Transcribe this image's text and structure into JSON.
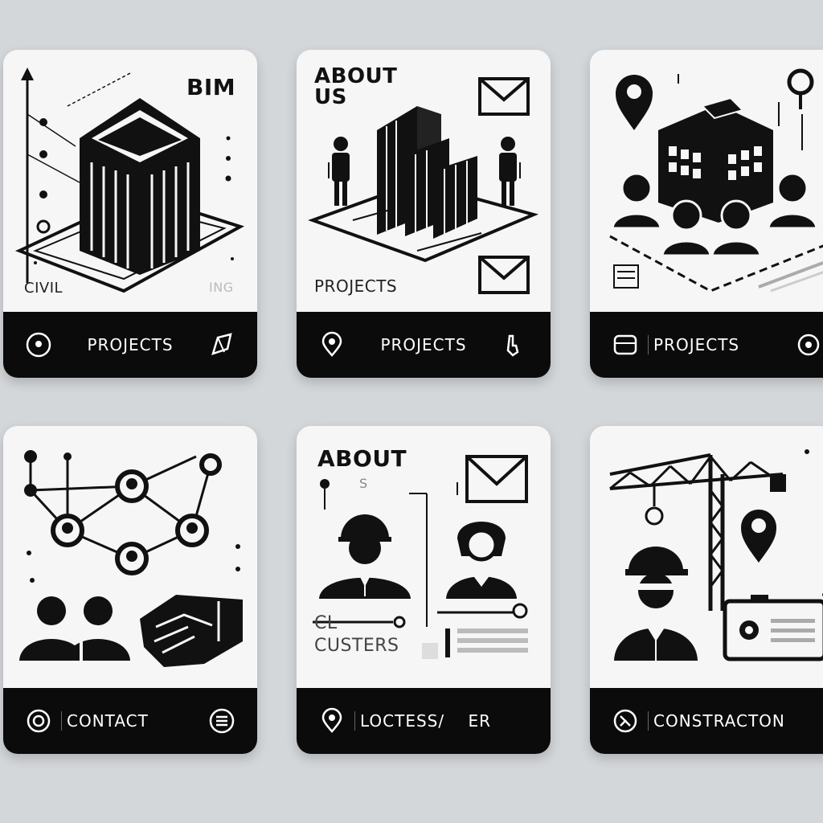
{
  "cards": [
    {
      "art_title": "BIM",
      "art_caption": "CIVIL",
      "art_faint": "ING",
      "footer_label": "PROJECTS",
      "left_icon": "location-pin-icon",
      "right_icon": "pen-nib-icon"
    },
    {
      "art_title": "ABOUT\nUS",
      "art_caption": "PROJECTS",
      "footer_label": "PROJECTS",
      "left_icon": "location-pin-icon",
      "right_icon": "hand-icon"
    },
    {
      "footer_label": "PROJECTS",
      "left_icon": "box-icon",
      "right_icon": "gear-icon"
    },
    {
      "footer_label": "CONTACT",
      "left_icon": "target-icon",
      "right_icon": "list-icon"
    },
    {
      "art_title": "ABOUT",
      "art_faint": "S",
      "art_caption": "CL\nCUSTERS",
      "footer_label": "LOCTESS/    ER",
      "left_icon": "location-pin-icon"
    },
    {
      "footer_label": "CONSTRACTON",
      "left_icon": "tool-icon"
    }
  ]
}
